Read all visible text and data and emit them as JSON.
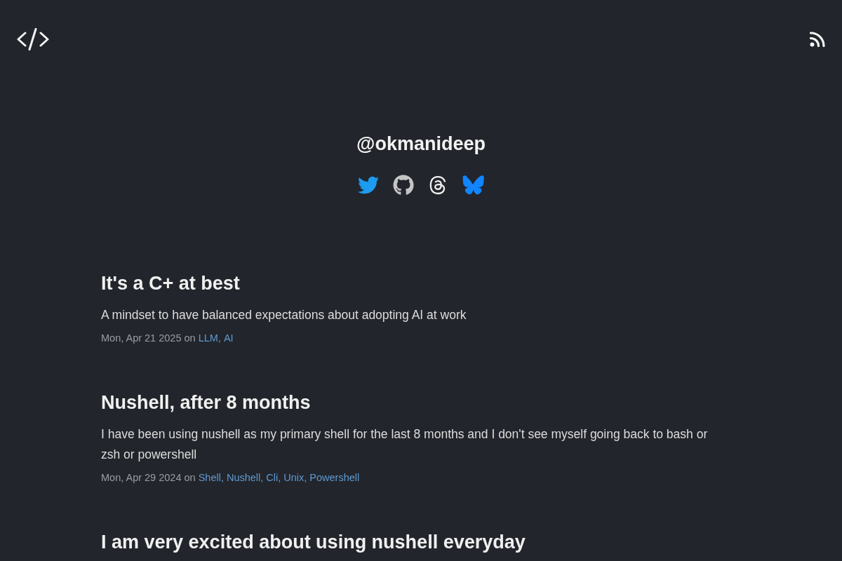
{
  "profile": {
    "handle": "@okmanideep"
  },
  "posts": [
    {
      "title": "It's a C+ at best",
      "summary": "A mindset to have balanced expectations about adopting AI at work",
      "meta": "Mon, Apr 21 2025 on",
      "tags": [
        "LLM,",
        "AI"
      ]
    },
    {
      "title": "Nushell, after 8 months",
      "summary": "I have been using nushell as my primary shell for the last 8 months and I don't see myself going back to bash or zsh or powershell",
      "meta": "Mon, Apr 29 2024 on",
      "tags": [
        "Shell,",
        "Nushell,",
        "Cli,",
        "Unix,",
        "Powershell"
      ]
    },
    {
      "title": "I am very excited about using nushell everyday"
    }
  ]
}
